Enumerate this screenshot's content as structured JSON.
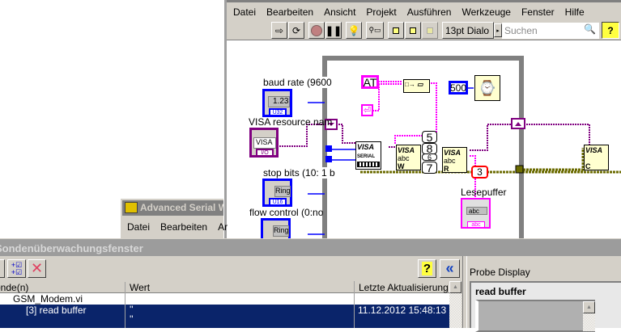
{
  "diagram_window": {
    "menu": [
      "Datei",
      "Bearbeiten",
      "Ansicht",
      "Projekt",
      "Ausführen",
      "Werkzeuge",
      "Fenster",
      "Hilfe"
    ],
    "toolbar": {
      "font": "13pt Dialo",
      "search_placeholder": "Suchen",
      "help": "?"
    },
    "controls": {
      "baud_rate": "baud rate (9600",
      "baud_value": "1.23",
      "baud_type": "U32",
      "visa_resource": "VISA resource nam",
      "visa_value": "VISA",
      "visa_type": "I/O",
      "stop_bits": "stop bits (10: 1 b",
      "stop_value": "Ring",
      "stop_type": "U16",
      "flow_control": "flow control (0:no",
      "flow_value": "Ring"
    },
    "constants": {
      "at": "AT",
      "timeout": "500",
      "c5": "5",
      "c8": "8",
      "c6": "6",
      "c7": "7",
      "c3": "3"
    },
    "nodes": {
      "visa": "VISA",
      "serial": "SERIAL",
      "abc": "abc",
      "write": "W",
      "read": "R",
      "close": "C"
    },
    "indicator": {
      "label": "Lesepuffer",
      "value": "abc",
      "type": "abc"
    }
  },
  "serial_window": {
    "title": "Advanced Serial W",
    "menu": [
      "Datei",
      "Bearbeiten",
      "Ar"
    ]
  },
  "probe_window": {
    "title": "Sondenüberwachungsfenster",
    "columns": [
      "Sonde(n)",
      "Wert",
      "Letzte Aktualisierung"
    ],
    "rows": [
      {
        "name": "GSM_Modem.vi",
        "value": "",
        "time": ""
      },
      {
        "name": "[3] read buffer",
        "value": "''\n''",
        "time": "11.12.2012 15:48:13"
      }
    ],
    "help": "?",
    "collapse": "«",
    "probe_display": {
      "title": "Probe Display",
      "label": "read buffer"
    }
  }
}
